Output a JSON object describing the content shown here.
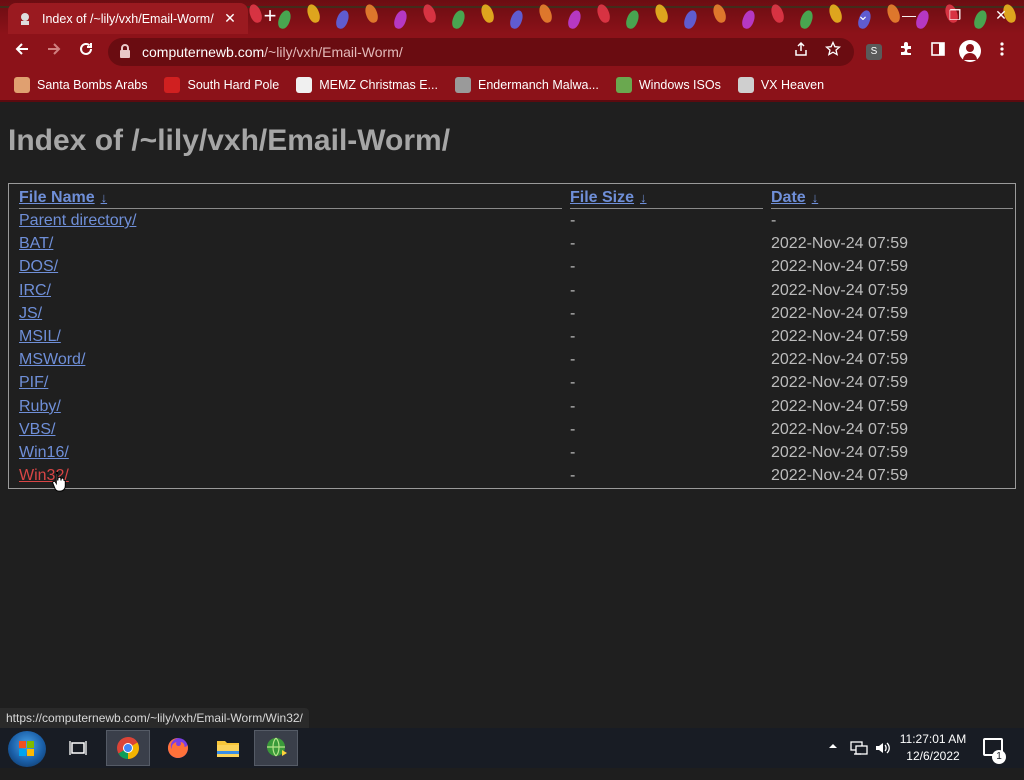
{
  "browser": {
    "tab_title": "Index of /~lily/vxh/Email-Worm/",
    "tab_close": "✕",
    "new_tab": "+",
    "url_host": "computernewb.com",
    "url_path": "/~lily/vxh/Email-Worm/",
    "window_controls": {
      "minimize": "—",
      "restore": "❐",
      "close": "✕",
      "tab_search": "⌄"
    },
    "extension_badge": "S",
    "bookmarks": [
      {
        "label": "Santa Bombs Arabs",
        "icon": "santa-icon",
        "color": "#e0a070"
      },
      {
        "label": "South Hard Pole",
        "icon": "snowflake-icon",
        "color": "#d02020"
      },
      {
        "label": "MEMZ Christmas E...",
        "icon": "memz-icon",
        "color": "#f0f0f0"
      },
      {
        "label": "Endermanch Malwa...",
        "icon": "enderman-icon",
        "color": "#9a9a9a"
      },
      {
        "label": "Windows ISOs",
        "icon": "elf-icon",
        "color": "#6aa84f"
      },
      {
        "label": "VX Heaven",
        "icon": "vx-heaven-icon",
        "color": "#cfcfcf"
      }
    ]
  },
  "page": {
    "title": "Index of /~lily/vxh/Email-Worm/",
    "columns": {
      "name": "File Name",
      "size": "File Size",
      "date": "Date",
      "sort_arrow": "↓"
    },
    "rows": [
      {
        "name": "Parent directory/",
        "size": "-",
        "date": "-"
      },
      {
        "name": "BAT/",
        "size": "-",
        "date": "2022-Nov-24 07:59"
      },
      {
        "name": "DOS/",
        "size": "-",
        "date": "2022-Nov-24 07:59"
      },
      {
        "name": "IRC/",
        "size": "-",
        "date": "2022-Nov-24 07:59"
      },
      {
        "name": "JS/",
        "size": "-",
        "date": "2022-Nov-24 07:59"
      },
      {
        "name": "MSIL/",
        "size": "-",
        "date": "2022-Nov-24 07:59"
      },
      {
        "name": "MSWord/",
        "size": "-",
        "date": "2022-Nov-24 07:59"
      },
      {
        "name": "PIF/",
        "size": "-",
        "date": "2022-Nov-24 07:59"
      },
      {
        "name": "Ruby/",
        "size": "-",
        "date": "2022-Nov-24 07:59"
      },
      {
        "name": "VBS/",
        "size": "-",
        "date": "2022-Nov-24 07:59"
      },
      {
        "name": "Win16/",
        "size": "-",
        "date": "2022-Nov-24 07:59"
      },
      {
        "name": "Win32/",
        "size": "-",
        "date": "2022-Nov-24 07:59"
      }
    ],
    "hover_link_index": 11,
    "link_color": "#6f8fd8",
    "hover_color": "#d94545"
  },
  "status_url": "https://computernewb.com/~lily/vxh/Email-Worm/Win32/",
  "taskbar": {
    "time": "11:27:01 AM",
    "date": "12/6/2022",
    "notification_count": "1"
  }
}
